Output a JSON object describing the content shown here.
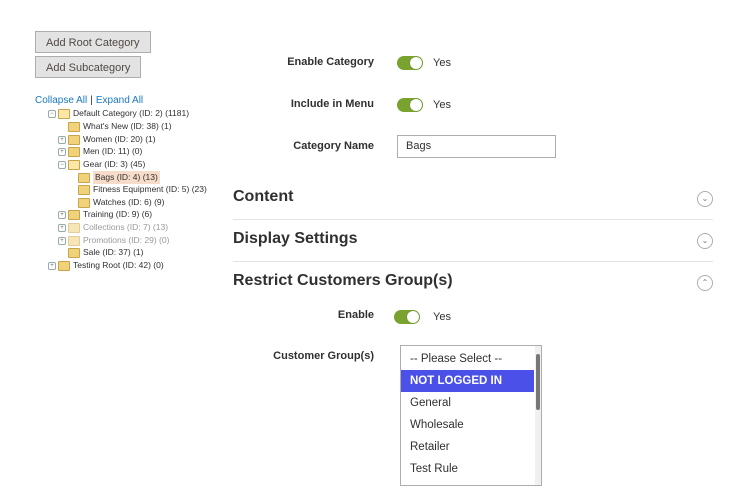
{
  "buttons": {
    "add_root": "Add Root Category",
    "add_sub": "Add Subcategory"
  },
  "tree": {
    "collapse_all": "Collapse All",
    "separator": "|",
    "expand_all": "Expand All",
    "nodes": [
      {
        "label": "Default Category (ID: 2) (1181)",
        "state": "expanded"
      },
      {
        "label": "What's New (ID: 38) (1)",
        "state": "leaf"
      },
      {
        "label": "Women (ID: 20) (1)",
        "state": "collapsed"
      },
      {
        "label": "Men (ID: 11) (0)",
        "state": "collapsed"
      },
      {
        "label": "Gear (ID: 3) (45)",
        "state": "expanded"
      },
      {
        "label": "Bags (ID: 4) (13)",
        "state": "leaf",
        "selected": true
      },
      {
        "label": "Fitness Equipment (ID: 5) (23)",
        "state": "leaf"
      },
      {
        "label": "Watches (ID: 6) (9)",
        "state": "leaf"
      },
      {
        "label": "Training (ID: 9) (6)",
        "state": "collapsed"
      },
      {
        "label": "Collections (ID: 7) (13)",
        "state": "collapsed",
        "disabled": true
      },
      {
        "label": "Promotions (ID: 29) (0)",
        "state": "collapsed",
        "disabled": true
      },
      {
        "label": "Sale (ID: 37) (1)",
        "state": "leaf"
      },
      {
        "label": "Testing Root (ID: 42) (0)",
        "state": "collapsed"
      }
    ]
  },
  "form": {
    "enable_category_label": "Enable Category",
    "enable_category_value": "Yes",
    "include_in_menu_label": "Include in Menu",
    "include_in_menu_value": "Yes",
    "category_name_label": "Category Name",
    "category_name_value": "Bags"
  },
  "sections": {
    "content": "Content",
    "display_settings": "Display Settings",
    "restrict_groups": "Restrict Customers Group(s)"
  },
  "restrict": {
    "enable_label": "Enable",
    "enable_value": "Yes",
    "customer_groups_label": "Customer Group(s)",
    "options": [
      "-- Please Select --",
      "NOT LOGGED IN",
      "General",
      "Wholesale",
      "Retailer",
      "Test Rule"
    ],
    "selected_option": "NOT LOGGED IN"
  },
  "colors": {
    "toggle_on": "#79a22e",
    "selected_option_bg": "#4b51e8",
    "link": "#1979c3"
  },
  "icons": {
    "section_collapsed": "chevron-down-icon",
    "section_expanded": "chevron-up-icon",
    "tree_folder": "folder-icon"
  }
}
